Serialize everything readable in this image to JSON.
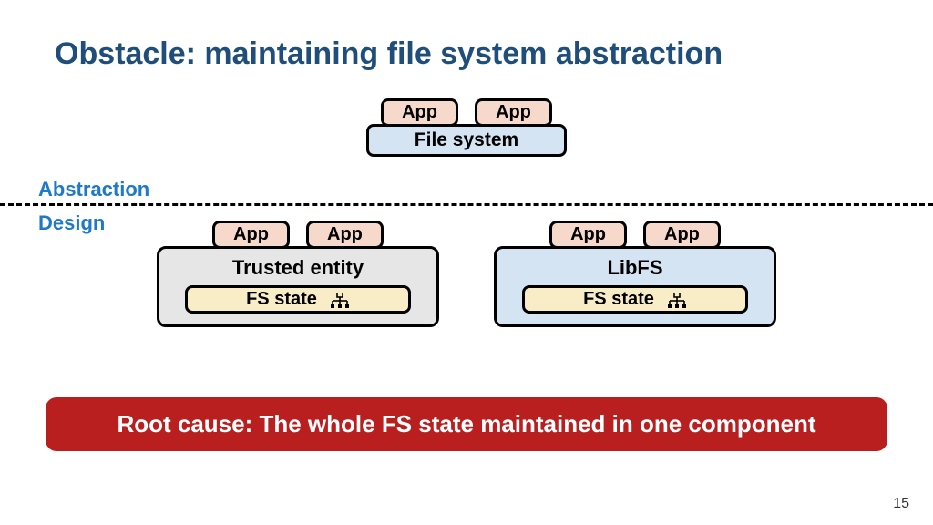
{
  "title": "Obstacle: maintaining file system abstraction",
  "labels": {
    "abstraction": "Abstraction",
    "design": "Design"
  },
  "abstraction": {
    "app1": "App",
    "app2": "App",
    "fs": "File system"
  },
  "design": {
    "left": {
      "app1": "App",
      "app2": "App",
      "container": "Trusted entity",
      "fsstate": "FS state"
    },
    "right": {
      "app1": "App",
      "app2": "App",
      "container": "LibFS",
      "fsstate": "FS state"
    }
  },
  "banner": "Root cause: The whole FS state maintained in one component",
  "page": "15"
}
